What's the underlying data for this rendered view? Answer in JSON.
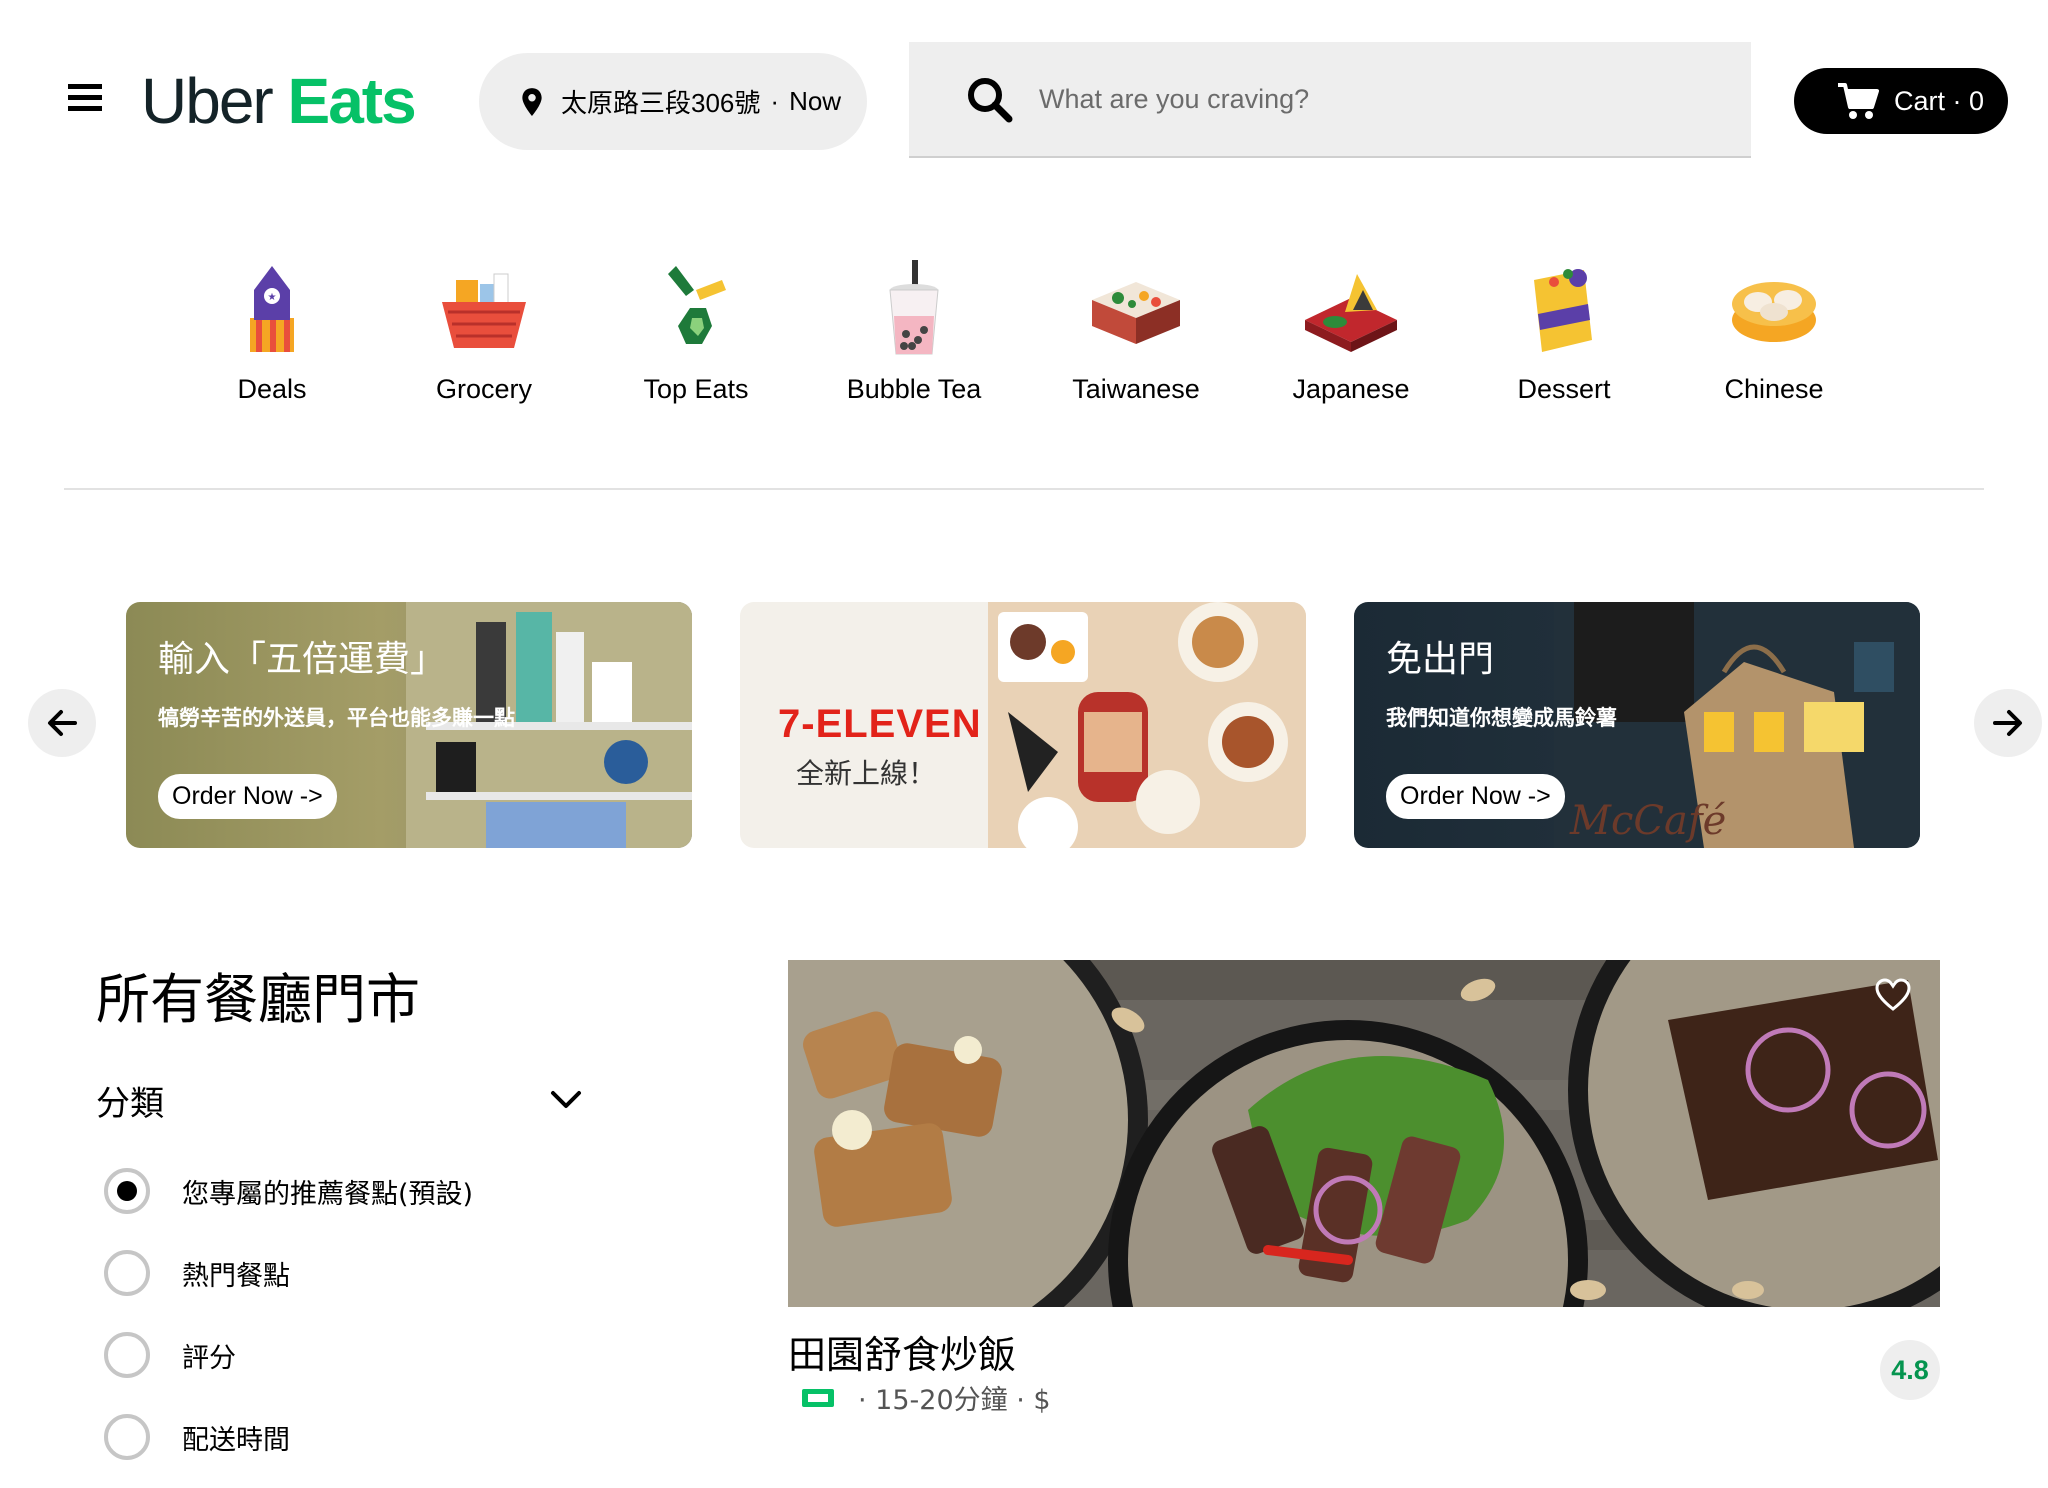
{
  "header": {
    "logo_part1": "Uber",
    "logo_part2": "Eats",
    "address": "太原路三段306號",
    "address_sep": "·",
    "time": "Now",
    "search_placeholder": "What are you craving?",
    "cart_label": "Cart · 0"
  },
  "categories": [
    {
      "label": "Deals",
      "icon": "deals-tag-icon"
    },
    {
      "label": "Grocery",
      "icon": "grocery-basket-icon"
    },
    {
      "label": "Top Eats",
      "icon": "top-eats-ribbon-icon"
    },
    {
      "label": "Bubble Tea",
      "icon": "bubble-tea-icon"
    },
    {
      "label": "Taiwanese",
      "icon": "taiwanese-bento-icon"
    },
    {
      "label": "Japanese",
      "icon": "japanese-sushi-icon"
    },
    {
      "label": "Dessert",
      "icon": "dessert-cake-icon"
    },
    {
      "label": "Chinese",
      "icon": "chinese-dumpling-icon"
    }
  ],
  "banners": [
    {
      "title": "輸入「五倍運費」",
      "subtitle": "犒勞辛苦的外送員，平台也能多賺一點",
      "button": "Order Now ->"
    },
    {
      "brand": "7-ELEVEN",
      "subtitle": "全新上線！"
    },
    {
      "title": "免出門",
      "subtitle": "我們知道你想變成馬鈴薯",
      "button": "Order Now ->",
      "brand_text": "McCafé"
    }
  ],
  "stores": {
    "section_title": "所有餐廳門市",
    "filter_heading": "分類",
    "sort_options": [
      {
        "label": "您專屬的推薦餐點(預設)",
        "checked": true
      },
      {
        "label": "熱門餐點",
        "checked": false
      },
      {
        "label": "評分",
        "checked": false
      },
      {
        "label": "配送時間",
        "checked": false
      }
    ]
  },
  "restaurant": {
    "name": "田園舒食炒飯",
    "meta": "· 15-20分鐘 · $",
    "rating": "4.8"
  },
  "colors": {
    "brand_green": "#06c167",
    "rating_green": "#05944f",
    "pill_gray": "#eeeeee"
  }
}
